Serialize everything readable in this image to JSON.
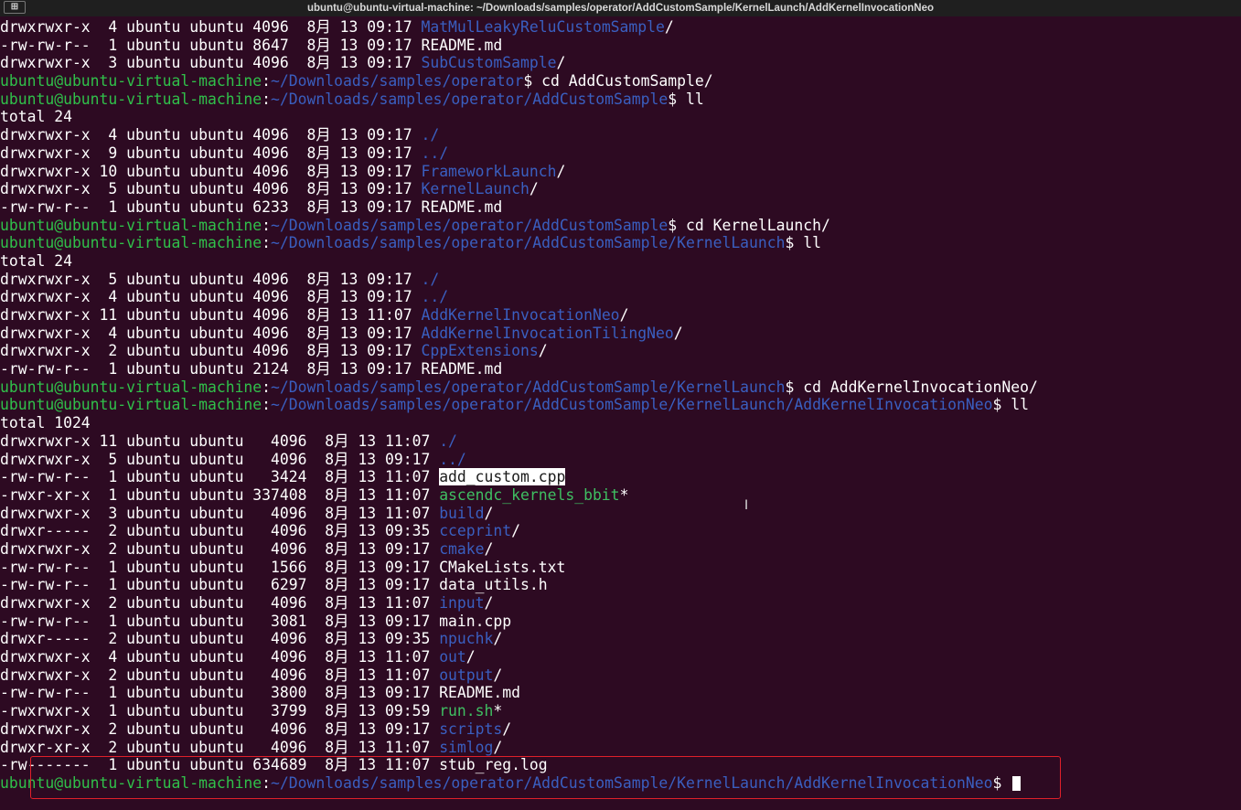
{
  "window": {
    "title": "ubuntu@ubuntu-virtual-machine: ~/Downloads/samples/operator/AddCustomSample/KernelLaunch/AddKernelInvocationNeo",
    "new_tab_icon": "new-tab-icon"
  },
  "colors": {
    "background": "#2d0a22",
    "prompt_user": "#30c04a",
    "prompt_path": "#3a5fc0",
    "directory": "#3a5fc0",
    "executable": "#3fbf62",
    "highlight_box": "#e0202a"
  },
  "cursor_icon": "text-cursor-icon",
  "terminal": {
    "lines": [
      [
        {
          "t": "drwxrwxr-x  4 ubuntu ubuntu 4096  8月 13 09:17 ",
          "c": "white"
        },
        {
          "t": "MatMulLeakyReluCustomSample",
          "c": "blue"
        },
        {
          "t": "/",
          "c": "white"
        }
      ],
      [
        {
          "t": "-rw-rw-r--  1 ubuntu ubuntu 8647  8月 13 09:17 README.md",
          "c": "white"
        }
      ],
      [
        {
          "t": "drwxrwxr-x  3 ubuntu ubuntu 4096  8月 13 09:17 ",
          "c": "white"
        },
        {
          "t": "SubCustomSample",
          "c": "blue"
        },
        {
          "t": "/",
          "c": "white"
        }
      ],
      [
        {
          "t": "ubuntu@ubuntu-virtual-machine",
          "c": "green"
        },
        {
          "t": ":",
          "c": "white"
        },
        {
          "t": "~/Downloads/samples/operator",
          "c": "path"
        },
        {
          "t": "$ cd AddCustomSample/",
          "c": "white"
        }
      ],
      [
        {
          "t": "ubuntu@ubuntu-virtual-machine",
          "c": "green"
        },
        {
          "t": ":",
          "c": "white"
        },
        {
          "t": "~/Downloads/samples/operator/AddCustomSample",
          "c": "path"
        },
        {
          "t": "$ ll",
          "c": "white"
        }
      ],
      [
        {
          "t": "total 24",
          "c": "white"
        }
      ],
      [
        {
          "t": "drwxrwxr-x  4 ubuntu ubuntu 4096  8月 13 09:17 ",
          "c": "white"
        },
        {
          "t": "./",
          "c": "blue"
        }
      ],
      [
        {
          "t": "drwxrwxr-x  9 ubuntu ubuntu 4096  8月 13 09:17 ",
          "c": "white"
        },
        {
          "t": "../",
          "c": "blue"
        }
      ],
      [
        {
          "t": "drwxrwxr-x 10 ubuntu ubuntu 4096  8月 13 09:17 ",
          "c": "white"
        },
        {
          "t": "FrameworkLaunch",
          "c": "blue"
        },
        {
          "t": "/",
          "c": "white"
        }
      ],
      [
        {
          "t": "drwxrwxr-x  5 ubuntu ubuntu 4096  8月 13 09:17 ",
          "c": "white"
        },
        {
          "t": "KernelLaunch",
          "c": "blue"
        },
        {
          "t": "/",
          "c": "white"
        }
      ],
      [
        {
          "t": "-rw-rw-r--  1 ubuntu ubuntu 6233  8月 13 09:17 README.md",
          "c": "white"
        }
      ],
      [
        {
          "t": "ubuntu@ubuntu-virtual-machine",
          "c": "green"
        },
        {
          "t": ":",
          "c": "white"
        },
        {
          "t": "~/Downloads/samples/operator/AddCustomSample",
          "c": "path"
        },
        {
          "t": "$ cd KernelLaunch/",
          "c": "white"
        }
      ],
      [
        {
          "t": "ubuntu@ubuntu-virtual-machine",
          "c": "green"
        },
        {
          "t": ":",
          "c": "white"
        },
        {
          "t": "~/Downloads/samples/operator/AddCustomSample/KernelLaunch",
          "c": "path"
        },
        {
          "t": "$ ll",
          "c": "white"
        }
      ],
      [
        {
          "t": "total 24",
          "c": "white"
        }
      ],
      [
        {
          "t": "drwxrwxr-x  5 ubuntu ubuntu 4096  8月 13 09:17 ",
          "c": "white"
        },
        {
          "t": "./",
          "c": "blue"
        }
      ],
      [
        {
          "t": "drwxrwxr-x  4 ubuntu ubuntu 4096  8月 13 09:17 ",
          "c": "white"
        },
        {
          "t": "../",
          "c": "blue"
        }
      ],
      [
        {
          "t": "drwxrwxr-x 11 ubuntu ubuntu 4096  8月 13 11:07 ",
          "c": "white"
        },
        {
          "t": "AddKernelInvocationNeo",
          "c": "blue"
        },
        {
          "t": "/",
          "c": "white"
        }
      ],
      [
        {
          "t": "drwxrwxr-x  4 ubuntu ubuntu 4096  8月 13 09:17 ",
          "c": "white"
        },
        {
          "t": "AddKernelInvocationTilingNeo",
          "c": "blue"
        },
        {
          "t": "/",
          "c": "white"
        }
      ],
      [
        {
          "t": "drwxrwxr-x  2 ubuntu ubuntu 4096  8月 13 09:17 ",
          "c": "white"
        },
        {
          "t": "CppExtensions",
          "c": "blue"
        },
        {
          "t": "/",
          "c": "white"
        }
      ],
      [
        {
          "t": "-rw-rw-r--  1 ubuntu ubuntu 2124  8月 13 09:17 README.md",
          "c": "white"
        }
      ],
      [
        {
          "t": "ubuntu@ubuntu-virtual-machine",
          "c": "green"
        },
        {
          "t": ":",
          "c": "white"
        },
        {
          "t": "~/Downloads/samples/operator/AddCustomSample/KernelLaunch",
          "c": "path"
        },
        {
          "t": "$ cd AddKernelInvocationNeo/",
          "c": "white"
        }
      ],
      [
        {
          "t": "ubuntu@ubuntu-virtual-machine",
          "c": "green"
        },
        {
          "t": ":",
          "c": "white"
        },
        {
          "t": "~/Downloads/samples/operator/AddCustomSample/KernelLaunch/AddKernelInvocationNeo",
          "c": "path"
        },
        {
          "t": "$ ll",
          "c": "white"
        }
      ],
      [
        {
          "t": "total 1024",
          "c": "white"
        }
      ],
      [
        {
          "t": "drwxrwxr-x 11 ubuntu ubuntu   4096  8月 13 11:07 ",
          "c": "white"
        },
        {
          "t": "./",
          "c": "blue"
        }
      ],
      [
        {
          "t": "drwxrwxr-x  5 ubuntu ubuntu   4096  8月 13 09:17 ",
          "c": "white"
        },
        {
          "t": "../",
          "c": "blue"
        }
      ],
      [
        {
          "t": "-rw-rw-r--  1 ubuntu ubuntu   3424  8月 13 11:07 ",
          "c": "white"
        },
        {
          "t": "add_custom.cpp",
          "c": "hl"
        }
      ],
      [
        {
          "t": "-rwxr-xr-x  1 ubuntu ubuntu 337408  8月 13 11:07 ",
          "c": "white"
        },
        {
          "t": "ascendc_kernels_bbit",
          "c": "exec"
        },
        {
          "t": "*",
          "c": "white"
        }
      ],
      [
        {
          "t": "drwxrwxr-x  3 ubuntu ubuntu   4096  8月 13 11:07 ",
          "c": "white"
        },
        {
          "t": "build",
          "c": "blue"
        },
        {
          "t": "/",
          "c": "white"
        }
      ],
      [
        {
          "t": "drwxr-----  2 ubuntu ubuntu   4096  8月 13 09:35 ",
          "c": "white"
        },
        {
          "t": "cceprint",
          "c": "blue"
        },
        {
          "t": "/",
          "c": "white"
        }
      ],
      [
        {
          "t": "drwxrwxr-x  2 ubuntu ubuntu   4096  8月 13 09:17 ",
          "c": "white"
        },
        {
          "t": "cmake",
          "c": "blue"
        },
        {
          "t": "/",
          "c": "white"
        }
      ],
      [
        {
          "t": "-rw-rw-r--  1 ubuntu ubuntu   1566  8月 13 09:17 CMakeLists.txt",
          "c": "white"
        }
      ],
      [
        {
          "t": "-rw-rw-r--  1 ubuntu ubuntu   6297  8月 13 09:17 data_utils.h",
          "c": "white"
        }
      ],
      [
        {
          "t": "drwxrwxr-x  2 ubuntu ubuntu   4096  8月 13 11:07 ",
          "c": "white"
        },
        {
          "t": "input",
          "c": "blue"
        },
        {
          "t": "/",
          "c": "white"
        }
      ],
      [
        {
          "t": "-rw-rw-r--  1 ubuntu ubuntu   3081  8月 13 09:17 main.cpp",
          "c": "white"
        }
      ],
      [
        {
          "t": "drwxr-----  2 ubuntu ubuntu   4096  8月 13 09:35 ",
          "c": "white"
        },
        {
          "t": "npuchk",
          "c": "blue"
        },
        {
          "t": "/",
          "c": "white"
        }
      ],
      [
        {
          "t": "drwxrwxr-x  4 ubuntu ubuntu   4096  8月 13 11:07 ",
          "c": "white"
        },
        {
          "t": "out",
          "c": "blue"
        },
        {
          "t": "/",
          "c": "white"
        }
      ],
      [
        {
          "t": "drwxrwxr-x  2 ubuntu ubuntu   4096  8月 13 11:07 ",
          "c": "white"
        },
        {
          "t": "output",
          "c": "blue"
        },
        {
          "t": "/",
          "c": "white"
        }
      ],
      [
        {
          "t": "-rw-rw-r--  1 ubuntu ubuntu   3800  8月 13 09:17 README.md",
          "c": "white"
        }
      ],
      [
        {
          "t": "-rwxrwxr-x  1 ubuntu ubuntu   3799  8月 13 09:59 ",
          "c": "white"
        },
        {
          "t": "run.sh",
          "c": "exec"
        },
        {
          "t": "*",
          "c": "white"
        }
      ],
      [
        {
          "t": "drwxrwxr-x  2 ubuntu ubuntu   4096  8月 13 09:17 ",
          "c": "white"
        },
        {
          "t": "scripts",
          "c": "blue"
        },
        {
          "t": "/",
          "c": "white"
        }
      ],
      [
        {
          "t": "drwxr-xr-x  2 ubuntu ubuntu   4096  8月 13 11:07 ",
          "c": "white"
        },
        {
          "t": "simlog",
          "c": "blue"
        },
        {
          "t": "/",
          "c": "white"
        }
      ],
      [
        {
          "t": "-rw-------  1 ubuntu ubuntu 634689  8月 13 11:07 stub_reg.log",
          "c": "white"
        }
      ],
      [
        {
          "t": "ubuntu@ubuntu-virtual-machine",
          "c": "green"
        },
        {
          "t": ":",
          "c": "white"
        },
        {
          "t": "~/Downloads/samples/operator/AddCustomSample/KernelLaunch/AddKernelInvocationNeo",
          "c": "path"
        },
        {
          "t": "$ ",
          "c": "white"
        },
        {
          "cursor": true
        }
      ]
    ]
  }
}
